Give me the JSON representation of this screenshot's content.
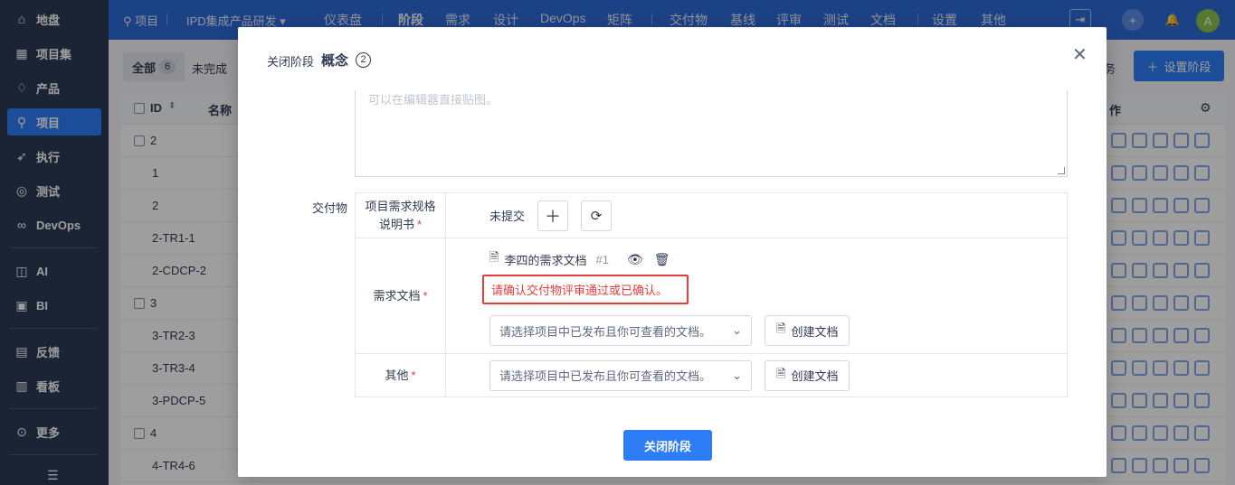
{
  "leftnav": {
    "items": [
      {
        "label": "地盘",
        "icon": "home-icon",
        "glyph": "⌂"
      },
      {
        "label": "项目集",
        "icon": "grid-icon",
        "glyph": "▦"
      },
      {
        "label": "产品",
        "icon": "bulb-icon",
        "glyph": "♢"
      },
      {
        "label": "项目",
        "icon": "rocket-icon",
        "glyph": "⚲"
      },
      {
        "label": "执行",
        "icon": "run-icon",
        "glyph": "➶"
      },
      {
        "label": "测试",
        "icon": "test-icon",
        "glyph": "◎"
      },
      {
        "label": "DevOps",
        "icon": "infinity-icon",
        "glyph": "∞"
      },
      {
        "label": "AI",
        "icon": "robot-icon",
        "glyph": "◫"
      },
      {
        "label": "BI",
        "icon": "chart-icon",
        "glyph": "▣"
      },
      {
        "label": "反馈",
        "icon": "feedback-icon",
        "glyph": "▤"
      },
      {
        "label": "看板",
        "icon": "kanban-icon",
        "glyph": "▥"
      },
      {
        "label": "更多",
        "icon": "more-icon",
        "glyph": "⊙"
      }
    ],
    "collapse_glyph": "☰"
  },
  "topnav": {
    "crumb_root": "项目",
    "crumb_project": "IPD集成产品研发",
    "items": [
      "仪表盘",
      "阶段",
      "需求",
      "设计",
      "DevOps",
      "矩阵",
      "交付物",
      "基线",
      "评审",
      "测试",
      "文档",
      "设置",
      "其他"
    ],
    "avatar": "A"
  },
  "page": {
    "tab_all": "全部",
    "tab_all_count": "6",
    "tab_undone": "未完成",
    "task_text": "务",
    "setup_button": "设置阶段",
    "col_id": "ID",
    "col_name": "名称",
    "col_actions": "作",
    "rows": [
      "2",
      "1",
      "2",
      "2-TR1-1",
      "2-CDCP-2",
      "3",
      "3-TR2-3",
      "3-TR3-4",
      "3-PDCP-5",
      "4",
      "4-TR4-6"
    ]
  },
  "modal": {
    "title_prefix": "关闭阶段",
    "title": "概念",
    "title_num": "2",
    "editor_placeholder": "可以在编辑器直接贴图。",
    "deliverables_label": "交付物",
    "row1": {
      "label": "项目需求规格说明书",
      "status": "未提交"
    },
    "row2": {
      "label": "需求文档",
      "doc_name": "李四的需求文档",
      "doc_version": "#1",
      "warning": "请确认交付物评审通过或已确认。",
      "select_placeholder": "请选择项目中已发布且你可查看的文档。",
      "create_button": "创建文档"
    },
    "row3": {
      "label": "其他",
      "select_placeholder": "请选择项目中已发布且你可查看的文档。",
      "create_button": "创建文档"
    },
    "submit_button": "关闭阶段"
  }
}
